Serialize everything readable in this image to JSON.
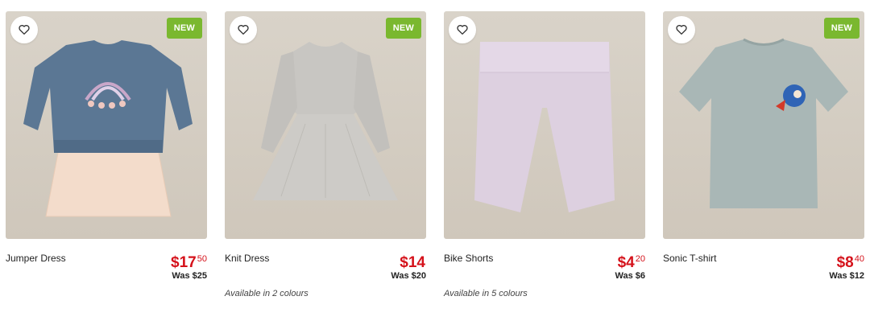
{
  "theme": {
    "price_color": "#d5121b",
    "badge_color": "#7ab82f"
  },
  "products": [
    {
      "name": "Jumper Dress",
      "price_dollars": "$17",
      "price_cents": "50",
      "was_price": "Was $25",
      "badge": "NEW",
      "colours_note": "",
      "favourite_icon": "heart-outline-icon"
    },
    {
      "name": "Knit Dress",
      "price_dollars": "$14",
      "price_cents": "",
      "was_price": "Was $20",
      "badge": "NEW",
      "colours_note": "Available in 2 colours",
      "favourite_icon": "heart-outline-icon"
    },
    {
      "name": "Bike Shorts",
      "price_dollars": "$4",
      "price_cents": "20",
      "was_price": "Was $6",
      "badge": "",
      "colours_note": "Available in 5 colours",
      "favourite_icon": "heart-outline-icon"
    },
    {
      "name": "Sonic T-shirt",
      "price_dollars": "$8",
      "price_cents": "40",
      "was_price": "Was $12",
      "badge": "NEW",
      "colours_note": "",
      "favourite_icon": "heart-outline-icon"
    }
  ]
}
